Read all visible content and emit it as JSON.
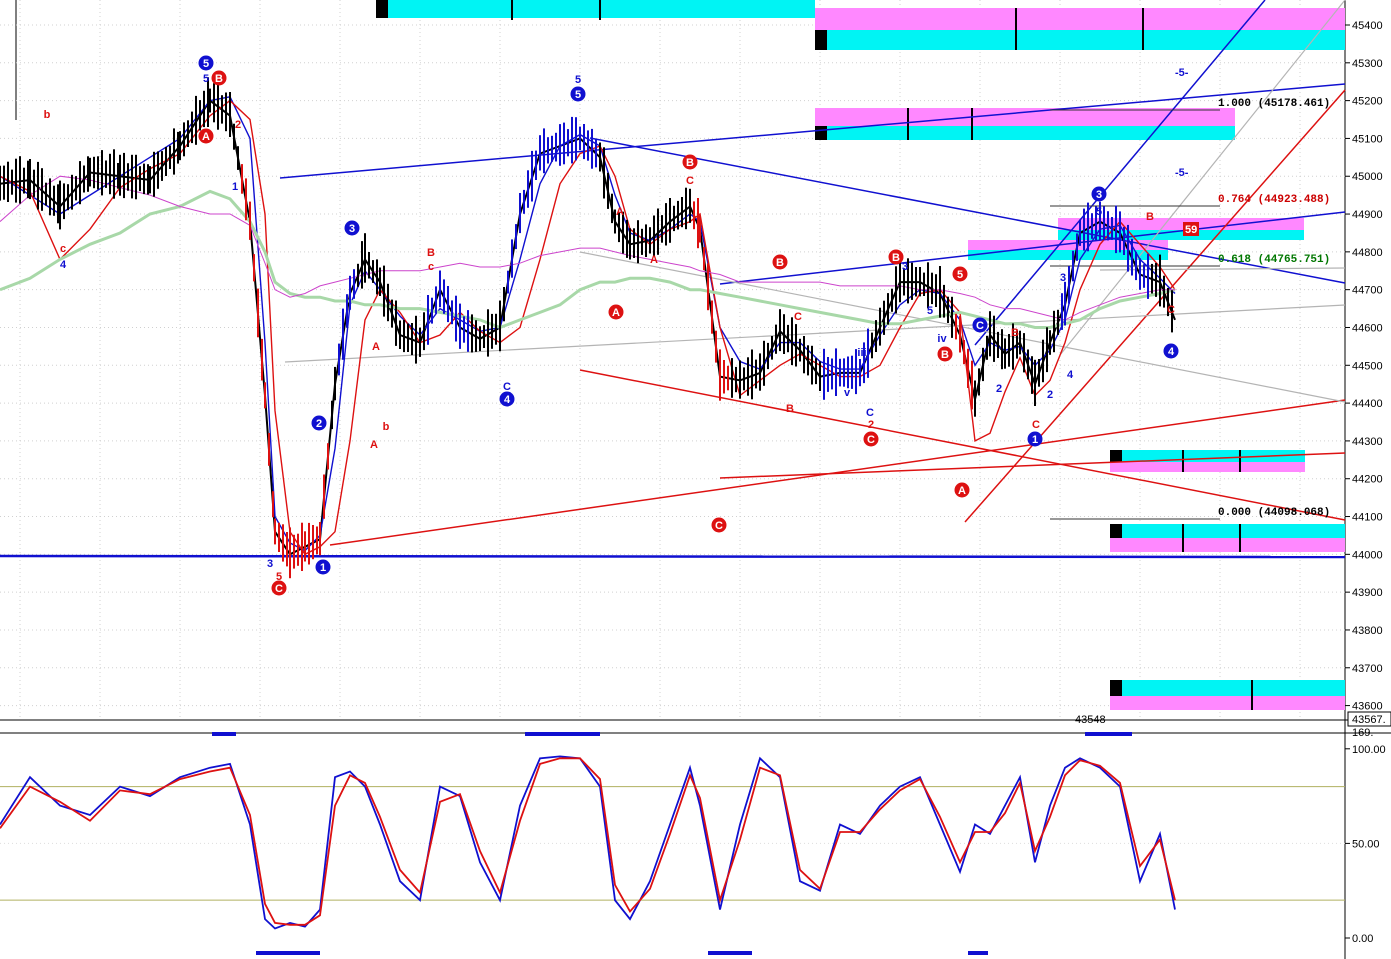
{
  "colors": {
    "blue": "#1010d0",
    "red": "#dd1111",
    "black": "#000000",
    "cyan": "#00f4f4",
    "magenta": "#ff88ff",
    "sma": "#a8d8a8",
    "ema": "#cc44cc",
    "grey": "#b4b4b4",
    "olive": "#b0b060",
    "fib_green": "#007700"
  },
  "price_axis": {
    "ticks": [
      "45400",
      "45300",
      "45200",
      "45100",
      "45000",
      "44900",
      "44800",
      "44700",
      "44600",
      "44500",
      "44400",
      "44300",
      "44200",
      "44100",
      "44000",
      "43900",
      "43800",
      "43700",
      "43600"
    ],
    "last_price": "43567.",
    "low_marker": "43548"
  },
  "fib_labels": {
    "f1000": "1.000  (45178.461)",
    "f0764": "0.764  (44923.488)",
    "f0618": "0.618  (44765.751)",
    "f0000": "0.000  (44098.068)",
    "flag": "59"
  },
  "osc_axis": {
    "top_value": "169.",
    "ticks": [
      "100.00",
      "50.00",
      "0.00"
    ]
  },
  "fifth_labels": [
    "-5-",
    "-5-"
  ],
  "chart_data": {
    "type": "line",
    "panels": [
      "price",
      "stochastic"
    ],
    "price_ylim": [
      43567,
      45450
    ],
    "stoch_ylim": [
      0,
      100
    ],
    "x": [
      0,
      30,
      60,
      90,
      120,
      150,
      180,
      210,
      230,
      250,
      265,
      275,
      290,
      305,
      320,
      335,
      350,
      365,
      380,
      400,
      420,
      440,
      460,
      480,
      500,
      520,
      540,
      560,
      580,
      600,
      615,
      630,
      650,
      670,
      690,
      700,
      720,
      740,
      760,
      780,
      800,
      820,
      840,
      860,
      880,
      900,
      920,
      940,
      960,
      975,
      990,
      1005,
      1020,
      1035,
      1050,
      1065,
      1080,
      1100,
      1120,
      1140,
      1160,
      1175
    ],
    "series": [
      {
        "values": [
          44980,
          44990,
          44920,
          45010,
          45000,
          44990,
          45080,
          45200,
          45160,
          44880,
          44420,
          44060,
          44000,
          44020,
          44040,
          44450,
          44690,
          44780,
          44720,
          44580,
          44560,
          44700,
          44600,
          44570,
          44600,
          44900,
          45060,
          45080,
          45100,
          45050,
          44880,
          44820,
          44830,
          44880,
          44920,
          44860,
          44470,
          44460,
          44480,
          44590,
          44540,
          44470,
          44480,
          44480,
          44600,
          44720,
          44720,
          44690,
          44580,
          44410,
          44580,
          44530,
          44560,
          44450,
          44560,
          44660,
          44850,
          44880,
          44850,
          44740,
          44720,
          44620
        ]
      },
      {
        "values": [
          45000,
          44950,
          44900,
          44950,
          45000,
          45050,
          45100,
          45200,
          45210,
          45100,
          44560,
          44100,
          44030,
          44010,
          44050,
          44280,
          44660,
          44750,
          44700,
          44630,
          44580,
          44650,
          44620,
          44590,
          44600,
          44780,
          44980,
          45080,
          45110,
          45080,
          44950,
          44850,
          44830,
          44860,
          44900,
          44880,
          44600,
          44510,
          44490,
          44560,
          44560,
          44510,
          44490,
          44490,
          44580,
          44660,
          44700,
          44690,
          44620,
          44500,
          44560,
          44540,
          44550,
          44500,
          44540,
          44620,
          44780,
          44860,
          44870,
          44780,
          44730,
          44690
        ]
      },
      {
        "values": [
          45000,
          44960,
          44780,
          44860,
          44970,
          45020,
          45060,
          45160,
          45200,
          45150,
          44900,
          44380,
          44060,
          44000,
          44020,
          44060,
          44300,
          44620,
          44700,
          44640,
          44560,
          44580,
          44640,
          44590,
          44560,
          44600,
          44780,
          44980,
          45060,
          45080,
          45000,
          44860,
          44820,
          44860,
          44880,
          44900,
          44600,
          44420,
          44460,
          44500,
          44530,
          44500,
          44470,
          44470,
          44500,
          44600,
          44690,
          44700,
          44640,
          44300,
          44320,
          44430,
          44520,
          44420,
          44460,
          44560,
          44700,
          44820,
          44880,
          44820,
          44760,
          44700
        ]
      },
      {
        "values": [
          44700,
          44730,
          44780,
          44820,
          44850,
          44900,
          44920,
          44960,
          44940,
          44880,
          44800,
          44720,
          44690,
          44680,
          44680,
          44670,
          44670,
          44660,
          44660,
          44650,
          44650,
          44640,
          44630,
          44620,
          44600,
          44620,
          44640,
          44660,
          44700,
          44720,
          44720,
          44730,
          44730,
          44720,
          44700,
          44700,
          44690,
          44680,
          44670,
          44660,
          44650,
          44640,
          44630,
          44620,
          44610,
          44610,
          44620,
          44630,
          44640,
          44630,
          44620,
          44610,
          44610,
          44600,
          44600,
          44610,
          44620,
          44650,
          44670,
          44680,
          44690,
          44700
        ]
      },
      {
        "values": [
          44880,
          44950,
          45000,
          44990,
          44970,
          44950,
          44920,
          44900,
          44900,
          44870,
          44770,
          44700,
          44680,
          44690,
          44710,
          44720,
          44730,
          44740,
          44750,
          44750,
          44750,
          44760,
          44770,
          44760,
          44760,
          44770,
          44790,
          44800,
          44810,
          44810,
          44800,
          44790,
          44780,
          44770,
          44760,
          44750,
          44740,
          44720,
          44720,
          44720,
          44720,
          44720,
          44710,
          44710,
          44710,
          44710,
          44700,
          44700,
          44690,
          44680,
          44660,
          44650,
          44650,
          44640,
          44630,
          44620,
          44640,
          44660,
          44680,
          44690,
          44700,
          44700
        ]
      },
      {
        "values": [
          60,
          85,
          70,
          65,
          80,
          75,
          85,
          90,
          92,
          60,
          10,
          5,
          8,
          6,
          15,
          85,
          88,
          80,
          60,
          30,
          20,
          80,
          75,
          40,
          20,
          70,
          95,
          96,
          95,
          80,
          20,
          10,
          30,
          60,
          90,
          70,
          15,
          60,
          95,
          85,
          30,
          25,
          60,
          55,
          70,
          80,
          85,
          60,
          35,
          60,
          55,
          70,
          85,
          40,
          70,
          90,
          95,
          90,
          80,
          30,
          55,
          15
        ]
      },
      {
        "values": [
          58,
          80,
          72,
          62,
          78,
          76,
          84,
          88,
          90,
          65,
          18,
          8,
          7,
          7,
          12,
          70,
          86,
          82,
          64,
          36,
          24,
          72,
          76,
          46,
          24,
          62,
          92,
          95,
          95,
          84,
          28,
          14,
          26,
          55,
          86,
          74,
          20,
          52,
          90,
          86,
          36,
          26,
          56,
          56,
          68,
          78,
          84,
          64,
          40,
          56,
          56,
          66,
          82,
          46,
          64,
          86,
          94,
          91,
          82,
          38,
          52,
          20
        ]
      }
    ],
    "hlines": [
      44000,
      45178.461,
      44923.488,
      44765.751,
      44098.068
    ],
    "wave_labels": [
      "5",
      "5",
      "B",
      "A",
      "b",
      "c",
      "4",
      "1",
      "2",
      "3",
      "5",
      "C",
      "1",
      "2",
      "3",
      "A",
      "b",
      "B",
      "c",
      "A",
      "C",
      "4",
      "5",
      "5",
      "A",
      "B",
      "C",
      "C",
      "A",
      "B",
      "C",
      "A",
      "B",
      "C",
      "2",
      "3",
      "5",
      "iv",
      "iii",
      "v",
      "C",
      "B",
      "5",
      "B",
      "A",
      "C",
      "1",
      "2",
      "3",
      "4",
      "C",
      "2",
      "B",
      "3",
      "5",
      "B",
      "C",
      "4"
    ]
  }
}
